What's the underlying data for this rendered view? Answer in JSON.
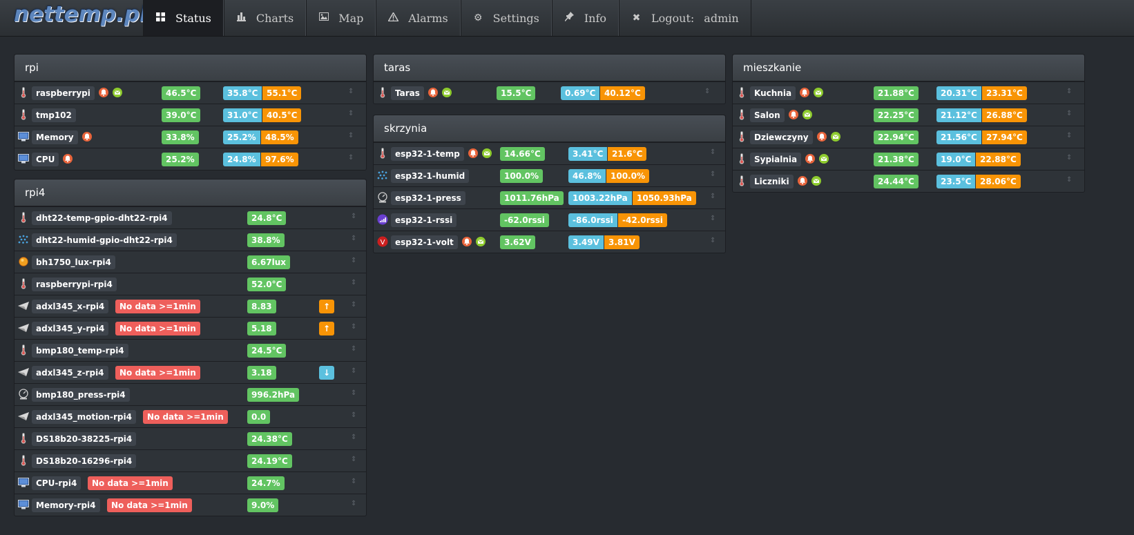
{
  "brand": "nettemp.pl",
  "nav": [
    {
      "label": "Status",
      "icon": "grid-icon",
      "glyph": "▦"
    },
    {
      "label": "Charts",
      "icon": "bar-chart-icon",
      "glyph": "▮"
    },
    {
      "label": "Map",
      "icon": "picture-icon",
      "glyph": "▣"
    },
    {
      "label": "Alarms",
      "icon": "warning-icon",
      "glyph": "⚠"
    },
    {
      "label": "Settings",
      "icon": "gear-icon",
      "glyph": "⚙"
    },
    {
      "label": "Info",
      "icon": "pushpin-icon",
      "glyph": "✎"
    },
    {
      "label": "Logout:",
      "icon": "close-icon",
      "glyph": "✖",
      "user": "admin"
    }
  ],
  "colors": {
    "green": "#62c462",
    "blue": "#5bc0de",
    "orange": "#f89406",
    "red": "#ee5f5b",
    "background": "#272b30"
  },
  "groups": {
    "rpi": {
      "title": "rpi",
      "sensors": [
        {
          "icon": "thermometer-icon",
          "name": "raspberrypi",
          "bell": true,
          "mail": true,
          "value": "46.5°C",
          "min": "35.8°C",
          "max": "55.1°C"
        },
        {
          "icon": "thermometer-icon",
          "name": "tmp102",
          "value": "39.0°C",
          "min": "31.0°C",
          "max": "40.5°C"
        },
        {
          "icon": "computer-icon",
          "name": "Memory",
          "bell": true,
          "value": "33.8%",
          "min": "25.2%",
          "max": "48.5%"
        },
        {
          "icon": "computer-icon",
          "name": "CPU",
          "bell": true,
          "value": "25.2%",
          "min": "24.8%",
          "max": "97.6%"
        }
      ]
    },
    "rpi4": {
      "title": "rpi4",
      "nodata_label": "No data >=1min",
      "sensors": [
        {
          "icon": "thermometer-icon",
          "name": "dht22-temp-gpio-dht22-rpi4",
          "value": "24.8°C"
        },
        {
          "icon": "humidity-icon",
          "name": "dht22-humid-gpio-dht22-rpi4",
          "value": "38.8%"
        },
        {
          "icon": "lux-icon",
          "name": "bh1750_lux-rpi4",
          "value": "6.67lux"
        },
        {
          "icon": "thermometer-icon",
          "name": "raspberrypi-rpi4",
          "value": "52.0°C"
        },
        {
          "icon": "accelerometer-icon",
          "name": "adxl345_x-rpi4",
          "nodata": true,
          "value": "8.83",
          "trend": "up"
        },
        {
          "icon": "accelerometer-icon",
          "name": "adxl345_y-rpi4",
          "nodata": true,
          "value": "5.18",
          "trend": "up"
        },
        {
          "icon": "thermometer-icon",
          "name": "bmp180_temp-rpi4",
          "value": "24.5°C"
        },
        {
          "icon": "accelerometer-icon",
          "name": "adxl345_z-rpi4",
          "nodata": true,
          "value": "3.18",
          "trend": "down"
        },
        {
          "icon": "pressure-icon",
          "name": "bmp180_press-rpi4",
          "value": "996.2hPa"
        },
        {
          "icon": "accelerometer-icon",
          "name": "adxl345_motion-rpi4",
          "nodata": true,
          "value": "0.0"
        },
        {
          "icon": "thermometer-icon",
          "name": "DS18b20-38225-rpi4",
          "value": "24.38°C"
        },
        {
          "icon": "thermometer-icon",
          "name": "DS18b20-16296-rpi4",
          "value": "24.19°C"
        },
        {
          "icon": "computer-icon",
          "name": "CPU-rpi4",
          "nodata": true,
          "value": "24.7%"
        },
        {
          "icon": "computer-icon",
          "name": "Memory-rpi4",
          "nodata": true,
          "value": "9.0%"
        }
      ]
    },
    "taras": {
      "title": "taras",
      "sensors": [
        {
          "icon": "thermometer-icon",
          "name": "Taras",
          "bell": true,
          "mail": true,
          "value": "15.5°C",
          "min": "0.69°C",
          "max": "40.12°C"
        }
      ]
    },
    "skrzynia": {
      "title": "skrzynia",
      "sensors": [
        {
          "icon": "thermometer-icon",
          "name": "esp32-1-temp",
          "bell": true,
          "mail": true,
          "value": "14.66°C",
          "min": "3.41°C",
          "max": "21.6°C"
        },
        {
          "icon": "humidity-icon",
          "name": "esp32-1-humid",
          "value": "100.0%",
          "min": "46.8%",
          "max": "100.0%"
        },
        {
          "icon": "pressure-icon",
          "name": "esp32-1-press",
          "value": "1011.76hPa",
          "min": "1003.22hPa",
          "max": "1050.93hPa"
        },
        {
          "icon": "signal-icon",
          "name": "esp32-1-rssi",
          "value": "-62.0rssi",
          "min": "-86.0rssi",
          "max": "-42.0rssi"
        },
        {
          "icon": "voltage-icon",
          "name": "esp32-1-volt",
          "bell": true,
          "mail": true,
          "value": "3.62V",
          "min": "3.49V",
          "max": "3.81V"
        }
      ]
    },
    "mieszkanie": {
      "title": "mieszkanie",
      "sensors": [
        {
          "icon": "thermometer-icon",
          "name": "Kuchnia",
          "bell": true,
          "mail": true,
          "value": "21.88°C",
          "min": "20.31°C",
          "max": "23.31°C"
        },
        {
          "icon": "thermometer-icon",
          "name": "Salon",
          "bell": true,
          "mail": true,
          "value": "22.25°C",
          "min": "21.12°C",
          "max": "26.88°C"
        },
        {
          "icon": "thermometer-icon",
          "name": "Dziewczyny",
          "bell": true,
          "mail": true,
          "value": "22.94°C",
          "min": "21.56°C",
          "max": "27.94°C"
        },
        {
          "icon": "thermometer-icon",
          "name": "Sypialnia",
          "bell": true,
          "mail": true,
          "value": "21.38°C",
          "min": "19.0°C",
          "max": "22.88°C"
        },
        {
          "icon": "thermometer-icon",
          "name": "Liczniki",
          "bell": true,
          "mail": true,
          "value": "24.44°C",
          "min": "23.5°C",
          "max": "28.06°C"
        }
      ]
    }
  }
}
